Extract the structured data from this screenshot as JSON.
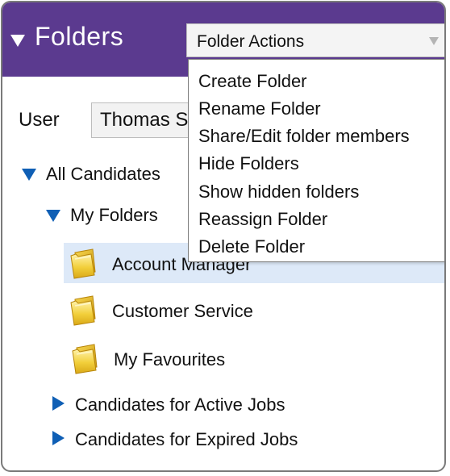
{
  "header": {
    "title": "Folders",
    "collapse_icon": "triangle-down-icon",
    "background_color": "#5b3a8f"
  },
  "folder_actions": {
    "label": "Folder Actions",
    "arrow_icon": "chevron-down-icon",
    "menu_items": [
      "Create Folder",
      "Rename Folder",
      "Share/Edit folder members",
      "Hide Folders",
      "Show hidden folders",
      "Reassign Folder",
      "Delete Folder"
    ]
  },
  "user": {
    "label": "User",
    "selected_value": "Thomas S"
  },
  "tree": {
    "all_candidates": "All Candidates",
    "my_folders": "My Folders",
    "folders": [
      "Account Manager",
      "Customer Service",
      "My Favourites"
    ],
    "selected_folder": "Account Manager",
    "active_jobs": "Candidates for Active Jobs",
    "expired_jobs": "Candidates for Expired Jobs",
    "expander_color": "#0f5fb5",
    "highlight_color": "#dde9f8"
  }
}
